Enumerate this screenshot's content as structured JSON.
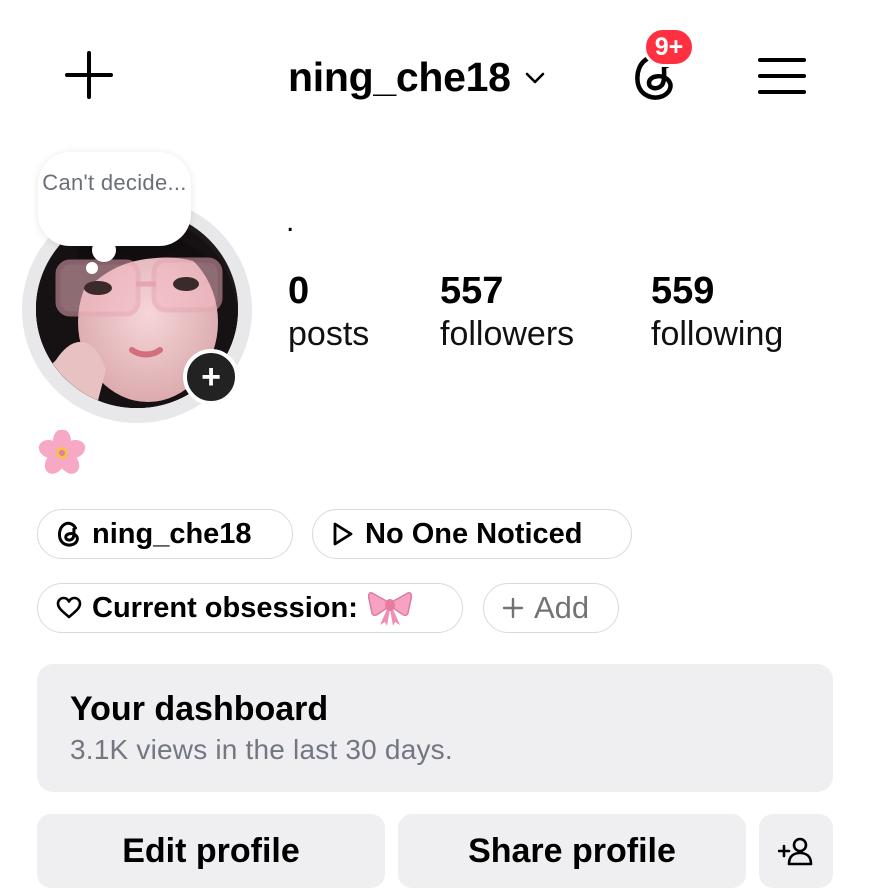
{
  "header": {
    "create_icon": "plus-icon",
    "username": "ning_che18",
    "switch_icon": "chevron-down-icon",
    "threads_icon": "threads-icon",
    "notification_badge": "9+",
    "menu_icon": "hamburger-menu-icon",
    "badge_color": "#ff3040"
  },
  "profile": {
    "note_text": "Can't decide...",
    "bio_dot": ".",
    "stats": [
      {
        "value": "0",
        "label": "posts"
      },
      {
        "value": "557",
        "label": "followers"
      },
      {
        "value": "559",
        "label": "following"
      }
    ],
    "bio_emoji": "cherry-blossom"
  },
  "links": {
    "threads_handle": "ning_che18",
    "music_track": "No One Noticed",
    "obsession_label": "Current obsession:",
    "add_label": "Add"
  },
  "dashboard": {
    "title": "Your dashboard",
    "subtitle": "3.1K views in the last 30 days."
  },
  "actions": {
    "edit_label": "Edit profile",
    "share_label": "Share profile",
    "discover_icon": "add-person-icon"
  }
}
